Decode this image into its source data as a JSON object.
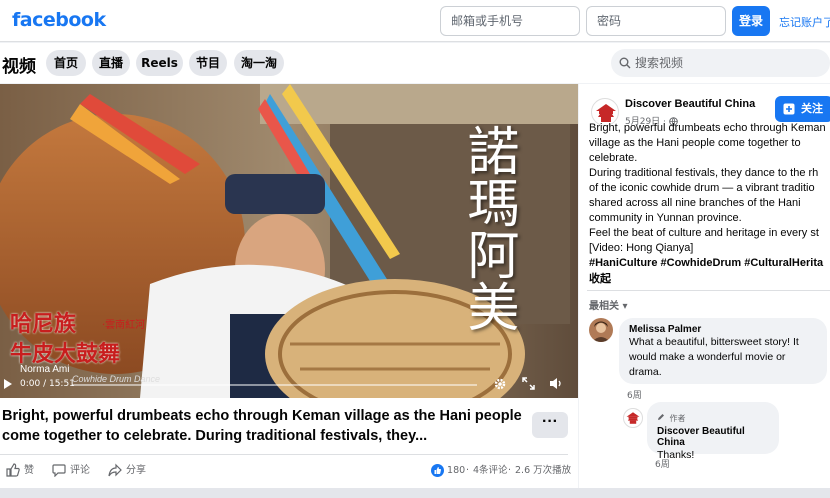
{
  "header": {
    "logo": "facebook",
    "email_placeholder": "邮箱或手机号",
    "password_placeholder": "密码",
    "login_label": "登录",
    "forgot_label": "忘记账户了"
  },
  "nav": {
    "section_title": "视频",
    "pills": [
      "首页",
      "直播",
      "Reels",
      "节目",
      "淘一淘"
    ],
    "search_placeholder": "搜索视频"
  },
  "video": {
    "overlay_vertical_text": "諾瑪阿美",
    "overlay_caption_1": "哈尼族",
    "overlay_caption_sub": "·雲南紅河",
    "overlay_caption_2": "牛皮大鼓舞",
    "overlay_subtitle": "Norma Ami",
    "overlay_subtitle_2": "Cowhide Drum Dance",
    "time": "0:00 / 15:51"
  },
  "post": {
    "title": "Bright, powerful drumbeats echo through Keman village as the Hani people come together to celebrate. During traditional festivals, they...",
    "more_label": "···",
    "actions": {
      "like": "赞",
      "comment": "评论",
      "share": "分享"
    },
    "stats": {
      "reactions": "180",
      "comments": "4条评论",
      "views": "2.6 万次播放",
      "separator": "·"
    }
  },
  "side": {
    "page_name": "Discover Beautiful China",
    "date": "5月29日 ·",
    "follow_label": "关注",
    "description": [
      "Bright, powerful drumbeats echo through Keman",
      "village as the Hani people come together to",
      "celebrate.",
      "During traditional festivals, they dance to the rh",
      "of the iconic cowhide drum — a vibrant traditio",
      "shared across all nine branches of the Hani",
      "community in Yunnan province.",
      "Feel the beat of culture and heritage in every st",
      "[Video: Hong Qianya]"
    ],
    "hashtags": "#HaniCulture #CowhideDrum #CulturalHerita",
    "collapse_label": "收起",
    "sort_label": "最相关 ▾",
    "comments": [
      {
        "name": "Melissa Palmer",
        "text_lines": [
          "What a beautiful, bittersweet story! It",
          "would make a wonderful movie or",
          "drama."
        ],
        "time": "6周"
      },
      {
        "badge": "作者",
        "name": "Discover Beautiful China",
        "text_lines": [
          "Thanks!"
        ],
        "time": "6周"
      }
    ]
  },
  "colors": {
    "brand": "#1877f2",
    "background": "#f0f2f5",
    "secondary_text": "#65676b"
  }
}
